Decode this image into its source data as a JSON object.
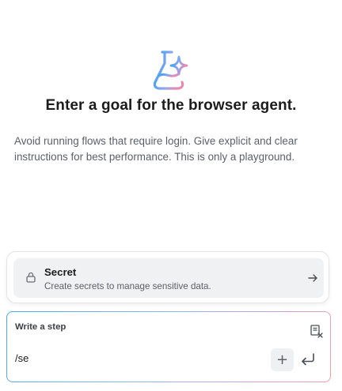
{
  "hero": {
    "icon": "flask-sparkle-icon",
    "title": "Enter a goal for the browser agent.",
    "subtitle": "Avoid running flows that require login. Give explicit and clear instructions for best performance. This is only a playground."
  },
  "suggestion": {
    "icon": "lock-icon",
    "title": "Secret",
    "description": "Create secrets to manage sensitive data.",
    "action_icon": "arrow-right-icon"
  },
  "composer": {
    "label": "Write a step",
    "value": "/se",
    "clear_icon": "clear-list-icon",
    "add_icon": "plus-icon",
    "add_label": "+",
    "submit_icon": "enter-icon"
  },
  "colors": {
    "gradient_start": "#4aa8f0",
    "gradient_end": "#f0a0a4",
    "card_bg": "#f0f1f3"
  }
}
